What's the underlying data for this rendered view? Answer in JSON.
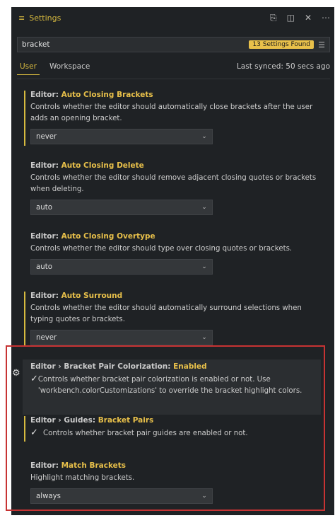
{
  "titlebar": {
    "menu_glyph": "≡",
    "title": "Settings",
    "icons": [
      "open-json-icon",
      "split-editor-icon",
      "close-icon",
      "more-icon"
    ]
  },
  "search": {
    "value": "bracket",
    "badge": "13 Settings Found",
    "filter_icon": "filter-icon"
  },
  "tabs": [
    {
      "label": "User",
      "active": true
    },
    {
      "label": "Workspace",
      "active": false
    }
  ],
  "synced": "Last synced: 50 secs ago",
  "settings": [
    {
      "prefix": "Editor: ",
      "name": "Auto Closing Brackets",
      "desc": "Controls whether the editor should automatically close brackets after the user adds an opening bracket.",
      "value": "never",
      "modified": true
    },
    {
      "prefix": "Editor: ",
      "name": "Auto Closing Delete",
      "desc": "Controls whether the editor should remove adjacent closing quotes or brackets when deleting.",
      "value": "auto",
      "modified": false
    },
    {
      "prefix": "Editor: ",
      "name": "Auto Closing Overtype",
      "desc": "Controls whether the editor should type over closing quotes or brackets.",
      "value": "auto",
      "modified": false
    },
    {
      "prefix": "Editor: ",
      "name": "Auto Surround",
      "desc": "Controls whether the editor should automatically surround selections when typing quotes or brackets.",
      "value": "never",
      "modified": true
    },
    {
      "prefix": "Editor › Bracket Pair Colorization: ",
      "name": "Enabled",
      "desc": "Controls whether bracket pair colorization is enabled or not. Use 'workbench.colorCustomizations' to override the bracket highlight colors.",
      "checked": true,
      "modified": false
    },
    {
      "prefix": "Editor › Guides: ",
      "name": "Bracket Pairs",
      "desc": "Controls whether bracket pair guides are enabled or not.",
      "checked": true,
      "modified": true
    },
    {
      "prefix": "Editor: ",
      "name": "Match Brackets",
      "desc": "Highlight matching brackets.",
      "value": "always",
      "modified": false
    }
  ],
  "colors": {
    "accent": "#d7ba3f",
    "badge": "#e8c04a",
    "highlight_border": "#c73333",
    "background": "#1f2225"
  }
}
